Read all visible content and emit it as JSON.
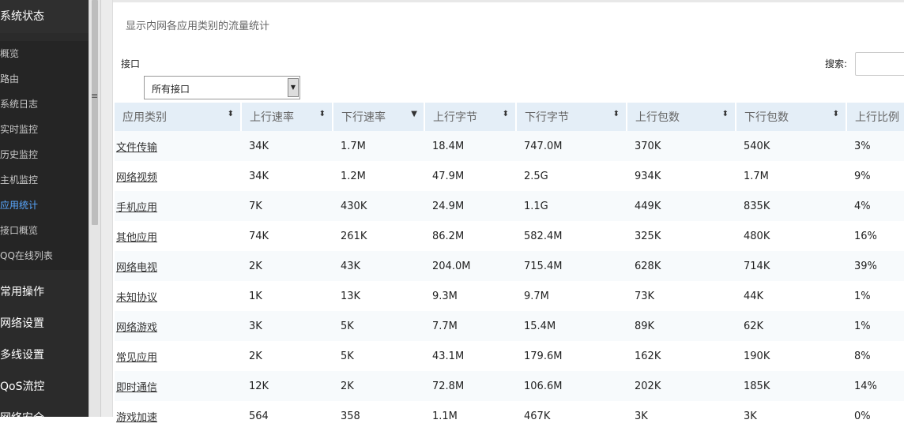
{
  "sidebar": {
    "top_section": "系统状态",
    "items": [
      "概览",
      "路由",
      "系统日志",
      "实时监控",
      "历史监控",
      "主机监控",
      "应用统计",
      "接口概览",
      "QQ在线列表"
    ],
    "active_item": "应用统计",
    "sections": [
      "常用操作",
      "网络设置",
      "多线设置",
      "QoS流控",
      "网络安全"
    ]
  },
  "splitter": {
    "grip": "≡"
  },
  "panel": {
    "title": "显示内网各应用类别的流量统计",
    "interface_label": "接口",
    "interface_value": "所有接口",
    "search_label": "搜索:"
  },
  "table": {
    "columns": [
      "应用类别",
      "上行速率",
      "下行速率",
      "上行字节",
      "下行字节",
      "上行包数",
      "下行包数",
      "上行比例"
    ],
    "sort_icons": [
      "⬍",
      "⬍",
      "▼",
      "⬍",
      "⬍",
      "⬍",
      "⬍",
      ""
    ],
    "rows": [
      [
        "文件传输",
        "34K",
        "1.7M",
        "18.4M",
        "747.0M",
        "370K",
        "540K",
        "3%"
      ],
      [
        "网络视频",
        "34K",
        "1.2M",
        "47.9M",
        "2.5G",
        "934K",
        "1.7M",
        "9%"
      ],
      [
        "手机应用",
        "7K",
        "430K",
        "24.9M",
        "1.1G",
        "449K",
        "835K",
        "4%"
      ],
      [
        "其他应用",
        "74K",
        "261K",
        "86.2M",
        "582.4M",
        "325K",
        "480K",
        "16%"
      ],
      [
        "网络电视",
        "2K",
        "43K",
        "204.0M",
        "715.4M",
        "628K",
        "714K",
        "39%"
      ],
      [
        "未知协议",
        "1K",
        "13K",
        "9.3M",
        "9.7M",
        "73K",
        "44K",
        "1%"
      ],
      [
        "网络游戏",
        "3K",
        "5K",
        "7.7M",
        "15.4M",
        "89K",
        "62K",
        "1%"
      ],
      [
        "常见应用",
        "2K",
        "5K",
        "43.1M",
        "179.6M",
        "162K",
        "190K",
        "8%"
      ],
      [
        "即时通信",
        "12K",
        "2K",
        "72.8M",
        "106.6M",
        "202K",
        "185K",
        "14%"
      ],
      [
        "游戏加速",
        "564",
        "358",
        "1.1M",
        "467K",
        "3K",
        "3K",
        "0%"
      ]
    ]
  }
}
